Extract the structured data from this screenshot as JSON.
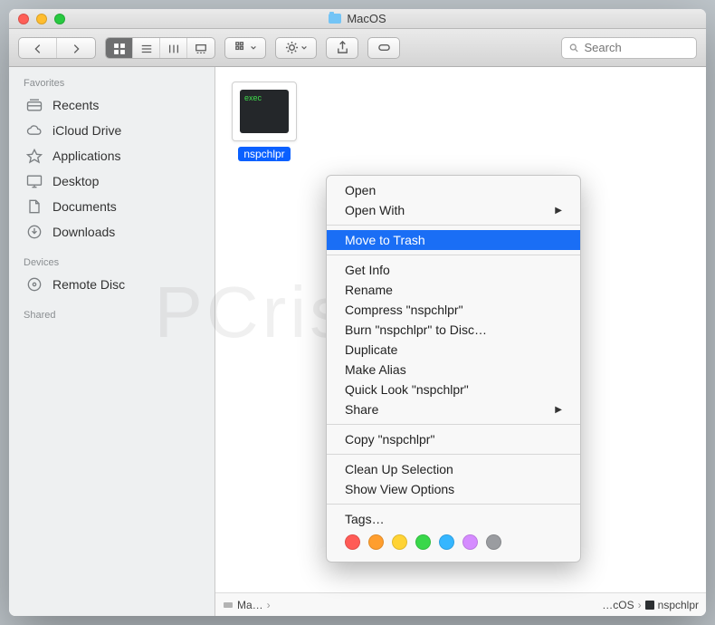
{
  "window": {
    "title": "MacOS"
  },
  "search": {
    "placeholder": "Search"
  },
  "sidebar": {
    "sections": [
      {
        "label": "Favorites",
        "items": [
          {
            "label": "Recents"
          },
          {
            "label": "iCloud Drive"
          },
          {
            "label": "Applications"
          },
          {
            "label": "Desktop"
          },
          {
            "label": "Documents"
          },
          {
            "label": "Downloads"
          }
        ]
      },
      {
        "label": "Devices",
        "items": [
          {
            "label": "Remote Disc"
          }
        ]
      },
      {
        "label": "Shared",
        "items": []
      }
    ]
  },
  "file": {
    "name": "nspchlpr",
    "exec_text": "exec"
  },
  "path": {
    "crumb1": "Ma…",
    "crumb_end1": "…cOS",
    "crumb_end2": "nspchlpr"
  },
  "context_menu": {
    "open": "Open",
    "open_with": "Open With",
    "move_to_trash": "Move to Trash",
    "get_info": "Get Info",
    "rename": "Rename",
    "compress": "Compress \"nspchlpr\"",
    "burn": "Burn \"nspchlpr\" to Disc…",
    "duplicate": "Duplicate",
    "make_alias": "Make Alias",
    "quick_look": "Quick Look \"nspchlpr\"",
    "share": "Share",
    "copy": "Copy \"nspchlpr\"",
    "clean_up": "Clean Up Selection",
    "view_options": "Show View Options",
    "tags": "Tags…"
  },
  "tag_colors": [
    "#ff5b56",
    "#ff9e2e",
    "#ffd335",
    "#39d74a",
    "#35b6ff",
    "#d58bff",
    "#9a9ca0"
  ],
  "watermark": "PCrisk.com"
}
